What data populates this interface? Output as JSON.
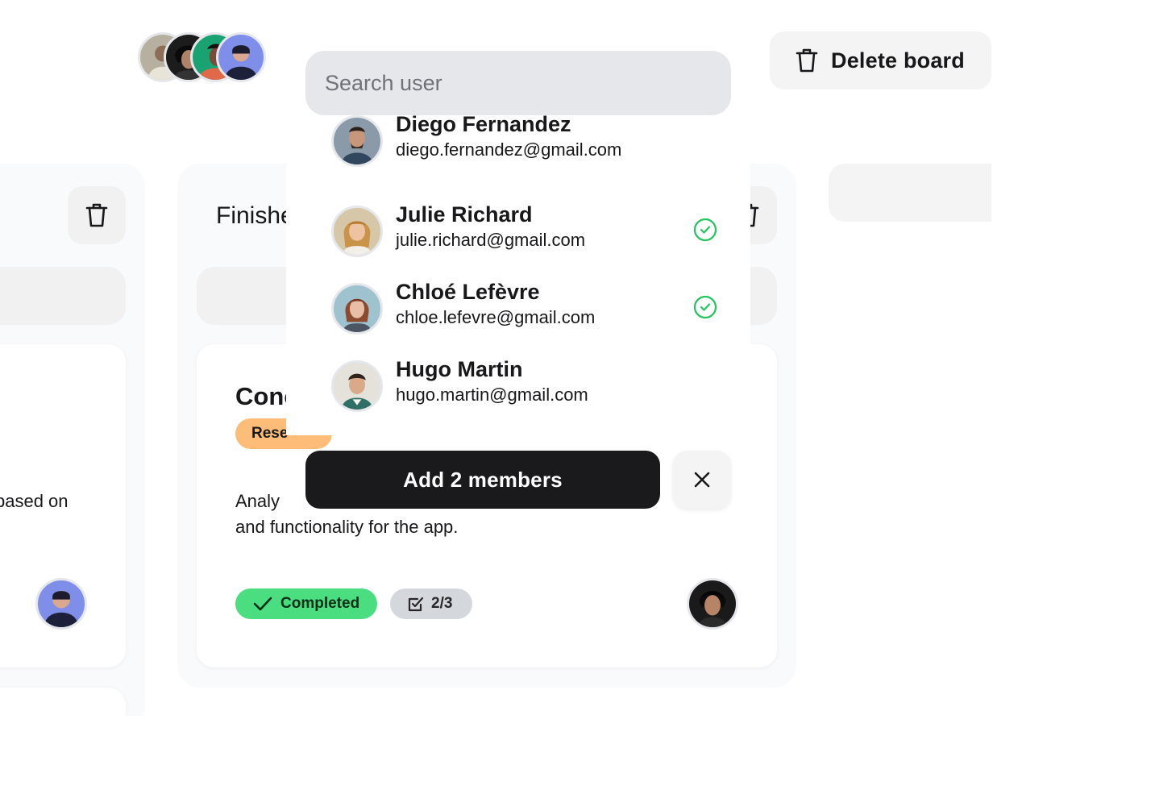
{
  "header": {
    "member_stack": [
      {
        "name": "member-avatar-1"
      },
      {
        "name": "member-avatar-2"
      },
      {
        "name": "member-avatar-3"
      },
      {
        "name": "member-avatar-4"
      }
    ],
    "delete_board_label": "Delete board",
    "delete_icon": "trash-icon"
  },
  "search": {
    "placeholder": "Search user",
    "value": ""
  },
  "users": [
    {
      "name": "Diego Fernandez",
      "email": "diego.fernandez@gmail.com",
      "selected": false
    },
    {
      "name": "Julie Richard",
      "email": "julie.richard@gmail.com",
      "selected": true
    },
    {
      "name": "Chloé Lefèvre",
      "email": "chloe.lefevre@gmail.com",
      "selected": true
    },
    {
      "name": "Hugo Martin",
      "email": "hugo.martin@gmail.com",
      "selected": false
    }
  ],
  "actions": {
    "add_label": "Add 2 members",
    "close_icon": "close-icon"
  },
  "board": {
    "left_column": {
      "card_desc_fragment": "based on"
    },
    "middle_column": {
      "title_fragment": "Finishe",
      "card": {
        "title_fragment": "Conc",
        "tag_fragment": "Rese",
        "desc_line1": "Analy",
        "desc_line2": "and functionality for the app.",
        "status_label": "Completed",
        "tasks_label": "2/3"
      }
    }
  },
  "colors": {
    "accent_dark": "#1a1a1c",
    "check_green": "#22c55e",
    "completed_green": "#4ade80",
    "tag_orange": "#fdbd78"
  }
}
